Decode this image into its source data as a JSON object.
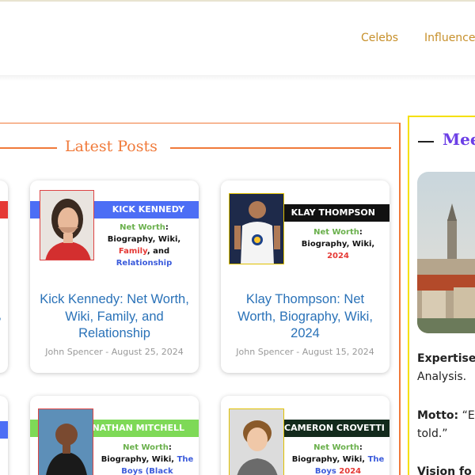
{
  "nav": {
    "items": [
      {
        "label": "Celebs"
      },
      {
        "label": "Influencers"
      }
    ]
  },
  "section": {
    "title": "Latest Posts"
  },
  "posts": [
    {
      "banner": "KICK KENNEDY",
      "banner_color": "#4c6ef5",
      "tagline_parts": [
        "Net Worth",
        ": Biography, Wiki, ",
        "Family",
        ", and ",
        "Relationship"
      ],
      "title": "Kick Kennedy: Net Worth, Wiki, Family, and Relationship",
      "meta": "John Spencer - August 25, 2024"
    },
    {
      "banner": "KLAY THOMPSON",
      "banner_color": "#111111",
      "tagline_parts": [
        "Net Worth",
        ": Biography, Wiki, ",
        "2024"
      ],
      "title": "Klay Thompson: Net Worth, Biography, Wiki, 2024",
      "meta": "John Spencer - August 15, 2024"
    },
    {
      "banner": "NATHAN MITCHELL",
      "banner_color": "#7ed957",
      "tagline_parts": [
        "Net Worth",
        ": Biography, Wiki, ",
        "The Boys (Black"
      ]
    },
    {
      "banner": "CAMERON CROVETTI",
      "banner_color": "#132a1c",
      "tagline_parts": [
        "Net Worth",
        ": Biography, Wiki, ",
        "The Boys",
        " 2024"
      ]
    }
  ],
  "stubs": {
    "left_top_text_1": "i,",
    "left_top_text_2": "y,"
  },
  "sidebar": {
    "title": "Mee",
    "expertise_label": "Expertise:",
    "expertise_rest": "Analysis.",
    "motto_label": "Motto:",
    "motto_value": "“Ev",
    "motto_rest": "told.”",
    "vision_label": "Vision fo"
  },
  "colors": {
    "accent_orange": "#f07a3a",
    "nav_gold": "#c7902b",
    "link_blue": "#2a72b8",
    "sidebar_border": "#f5e000",
    "sidebar_title": "#6c3fe6"
  }
}
